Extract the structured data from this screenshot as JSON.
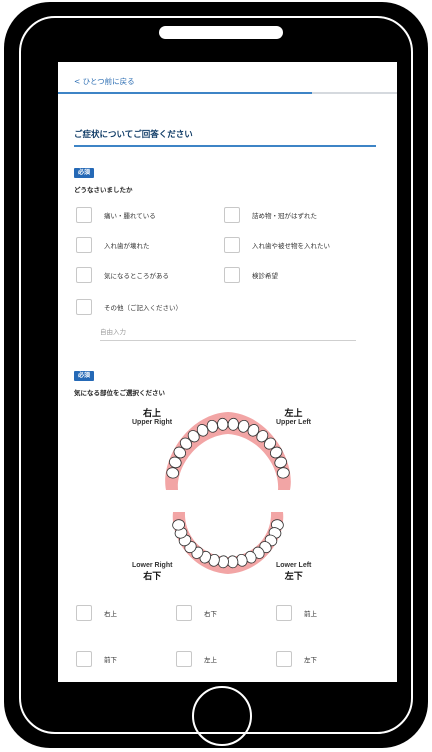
{
  "nav": {
    "back_label": "< ひとつ前に戻る",
    "progress_percent": 75
  },
  "section": {
    "title": "ご症状についてご回答ください"
  },
  "q1": {
    "required_label": "必須",
    "question": "どうなさいましたか",
    "options": [
      "痛い・腫れている",
      "詰め物・冠がはずれた",
      "入れ歯が壊れた",
      "入れ歯や被せ物を入れたい",
      "気になるところがある",
      "検診希望",
      "その他（ご記入ください）"
    ],
    "free_input_placeholder": "自由入力"
  },
  "q2": {
    "required_label": "必須",
    "question": "気になる部位をご選択ください",
    "diagram_labels": {
      "upper_right_jp": "右上",
      "upper_right_en": "Upper Right",
      "upper_left_jp": "左上",
      "upper_left_en": "Upper Left",
      "lower_right_en": "Lower Right",
      "lower_right_jp": "右下",
      "lower_left_en": "Lower Left",
      "lower_left_jp": "左下"
    },
    "options": [
      "右上",
      "右下",
      "前上",
      "前下",
      "左上",
      "左下"
    ]
  },
  "colors": {
    "accent": "#2569b6",
    "gum": "#f2a5a5",
    "title": "#0f3b66"
  }
}
